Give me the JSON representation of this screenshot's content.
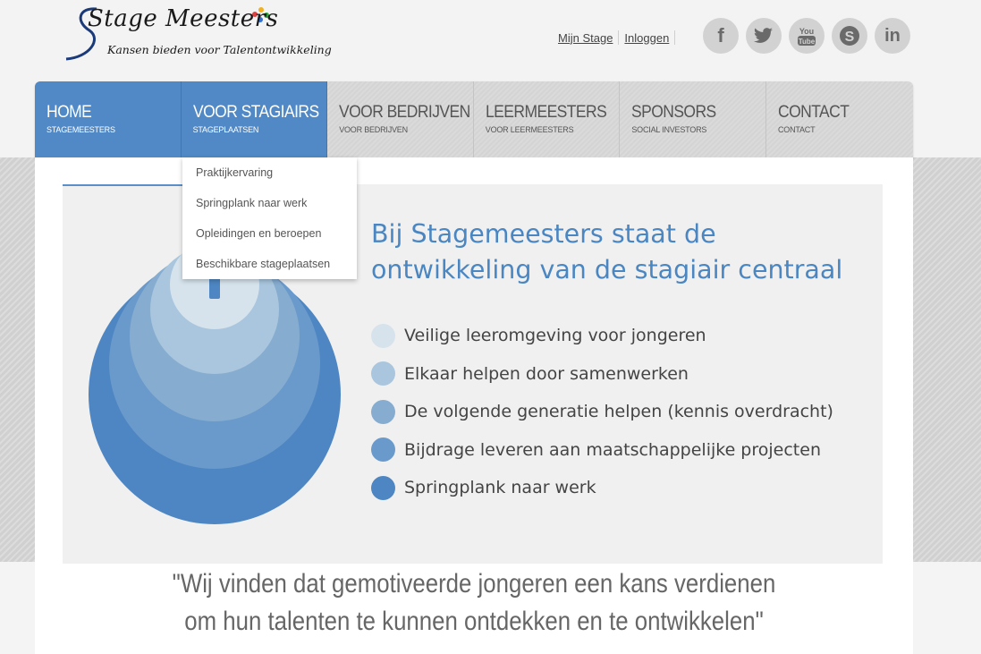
{
  "logo": {
    "name": "Stage Meesters",
    "tagline": "Kansen bieden voor Talentontwikkeling"
  },
  "top_links": [
    "Mijn Stage",
    "Inloggen"
  ],
  "social": [
    {
      "icon": "facebook-icon",
      "glyph": "f"
    },
    {
      "icon": "twitter-icon",
      "glyph": "❧"
    },
    {
      "icon": "youtube-icon",
      "glyph": "You\nTube"
    },
    {
      "icon": "skype-icon",
      "glyph": "S"
    },
    {
      "icon": "linkedin-icon",
      "glyph": "in"
    }
  ],
  "nav": [
    {
      "label": "HOME",
      "sub": "STAGEMEESTERS"
    },
    {
      "label": "VOOR STAGIAIRS",
      "sub": "STAGEPLAATSEN"
    },
    {
      "label": "VOOR BEDRIJVEN",
      "sub": "VOOR BEDRIJVEN"
    },
    {
      "label": "LEERMEESTERS",
      "sub": "VOOR LEERMEESTERS"
    },
    {
      "label": "SPONSORS",
      "sub": "SOCIAL INVESTORS"
    },
    {
      "label": "CONTACT",
      "sub": "CONTACT"
    }
  ],
  "dropdown": [
    "Praktijkervaring",
    "Springplank naar werk",
    "Opleidingen en beroepen",
    "Beschikbare stageplaatsen"
  ],
  "banner": {
    "heading_line1": "Bij Stagemeesters staat de",
    "heading_line2": "ontwikkeling van de stagiair centraal",
    "items": [
      "Veilige leeromgeving voor jongeren",
      "Elkaar helpen door samenwerken",
      "De volgende generatie helpen (kennis overdracht)",
      "Bijdrage leveren aan maatschappelijke projecten",
      "Springplank naar werk"
    ],
    "colors": [
      "#d6e3ec",
      "#a9c6de",
      "#86add0",
      "#6a9acb",
      "#4d86c2"
    ]
  },
  "quote": {
    "line1": "\"Wij vinden dat gemotiveerde jongeren een kans verdienen",
    "line2": "om hun talenten te kunnen ontdekken en te ontwikkelen\""
  }
}
